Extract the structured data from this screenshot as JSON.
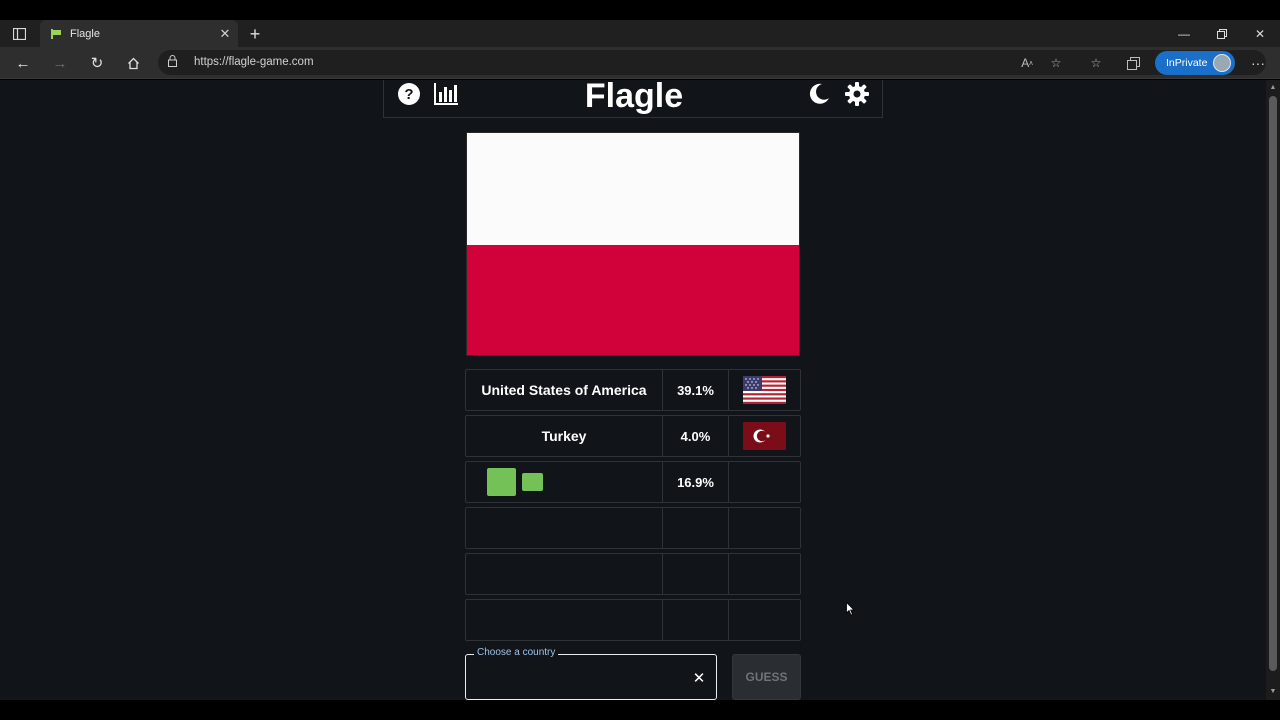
{
  "browser": {
    "tab_title": "Flagle",
    "url": "https://flagle-game.com",
    "inprivate_label": "InPrivate"
  },
  "app": {
    "title": "Flagle",
    "icons": [
      "help-icon",
      "stats-icon",
      "dark-mode-icon",
      "settings-icon"
    ]
  },
  "flag": {
    "top_color": "#fbfbfb",
    "bottom_color": "#d10239"
  },
  "guesses": [
    {
      "country": "United States of America",
      "percent": "39.1%",
      "flag_icon": "usa-flag-icon"
    },
    {
      "country": "Turkey",
      "percent": "4.0%",
      "flag_icon": "turkey-flag-icon"
    },
    {
      "country": "",
      "percent": "16.9%",
      "flag_icon": ""
    },
    {
      "country": "",
      "percent": "",
      "flag_icon": ""
    },
    {
      "country": "",
      "percent": "",
      "flag_icon": ""
    },
    {
      "country": "",
      "percent": "",
      "flag_icon": ""
    }
  ],
  "chooser": {
    "label": "Choose a country",
    "value": ""
  },
  "guess_button": "GUESS",
  "colors": {
    "accent": "#74c157",
    "background": "#111418"
  }
}
